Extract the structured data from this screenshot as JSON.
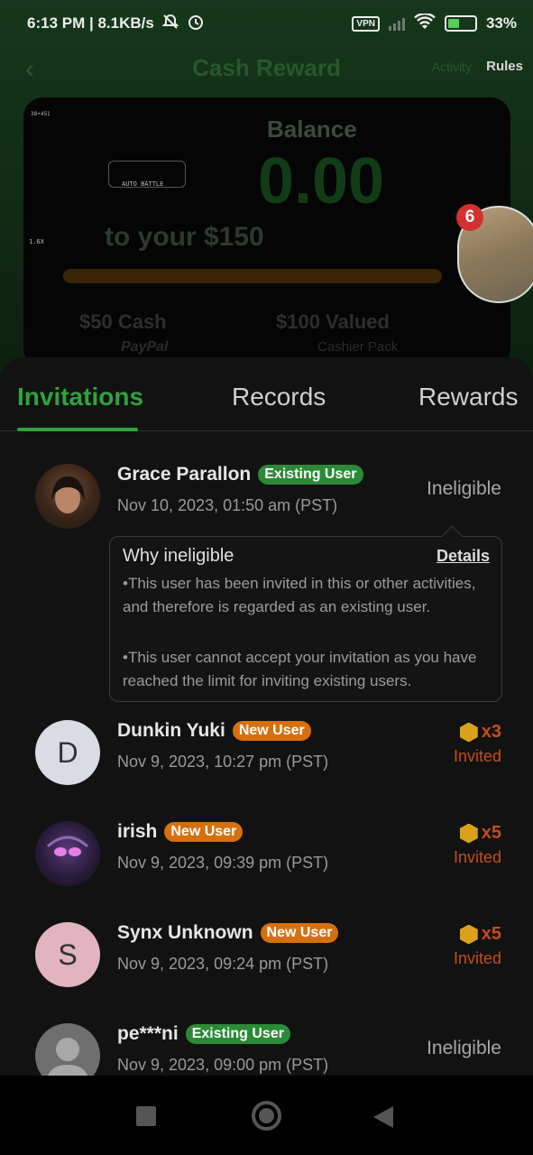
{
  "status_bar": {
    "time_speed": "6:13 PM | 8.1KB/s",
    "vpn": "VPN",
    "battery": "33%"
  },
  "background_page": {
    "title": "Cash Reward",
    "activity_label": "Activity",
    "rules_label": "Rules",
    "balance_label": "Balance",
    "balance_amount": "0.00",
    "subline": "to your $150",
    "option1_title": "$50 Cash",
    "option1_sub": "PayPal",
    "option2_title": "$100 Valued",
    "option2_sub": "Cashier Pack",
    "floating_badge_count": "6",
    "game_overlay_text": "AUTO BATTLE",
    "game_text_topleft": "38•451",
    "game_text_left": "1.6X"
  },
  "tabs": [
    {
      "label": "Invitations",
      "active": true
    },
    {
      "label": "Records",
      "active": false
    },
    {
      "label": "Rewards",
      "active": false
    }
  ],
  "invitations": [
    {
      "name": "Grace Parallon",
      "badge": "Existing User",
      "date": "Nov 10, 2023, 01:50 am (PST)",
      "status": "Ineligible"
    },
    {
      "name": "Dunkin Yuki",
      "initial": "D",
      "badge": "New User",
      "date": "Nov 9, 2023, 10:27 pm (PST)",
      "reward": "x3",
      "status": "Invited"
    },
    {
      "name": "irish",
      "badge": "New User",
      "date": "Nov 9, 2023, 09:39 pm (PST)",
      "reward": "x5",
      "status": "Invited"
    },
    {
      "name": "Synx Unknown",
      "initial": "S",
      "badge": "New User",
      "date": "Nov 9, 2023, 09:24 pm (PST)",
      "reward": "x5",
      "status": "Invited"
    },
    {
      "name": "pe***ni",
      "badge": "Existing User",
      "date": "Nov 9, 2023, 09:00 pm (PST)",
      "status": "Ineligible"
    }
  ],
  "tooltip": {
    "title": "Why ineligible",
    "details_link": "Details",
    "reason1": "•This user has been invited in this or other activities, and therefore is regarded as an existing user.",
    "reason2": "•This user cannot accept your invitation as you have reached the limit for inviting existing users."
  },
  "colors": {
    "accent_green": "#31a23e",
    "new_user_badge": "#d6700f",
    "invited_text": "#c64c1c",
    "coin": "#d9a21a"
  }
}
